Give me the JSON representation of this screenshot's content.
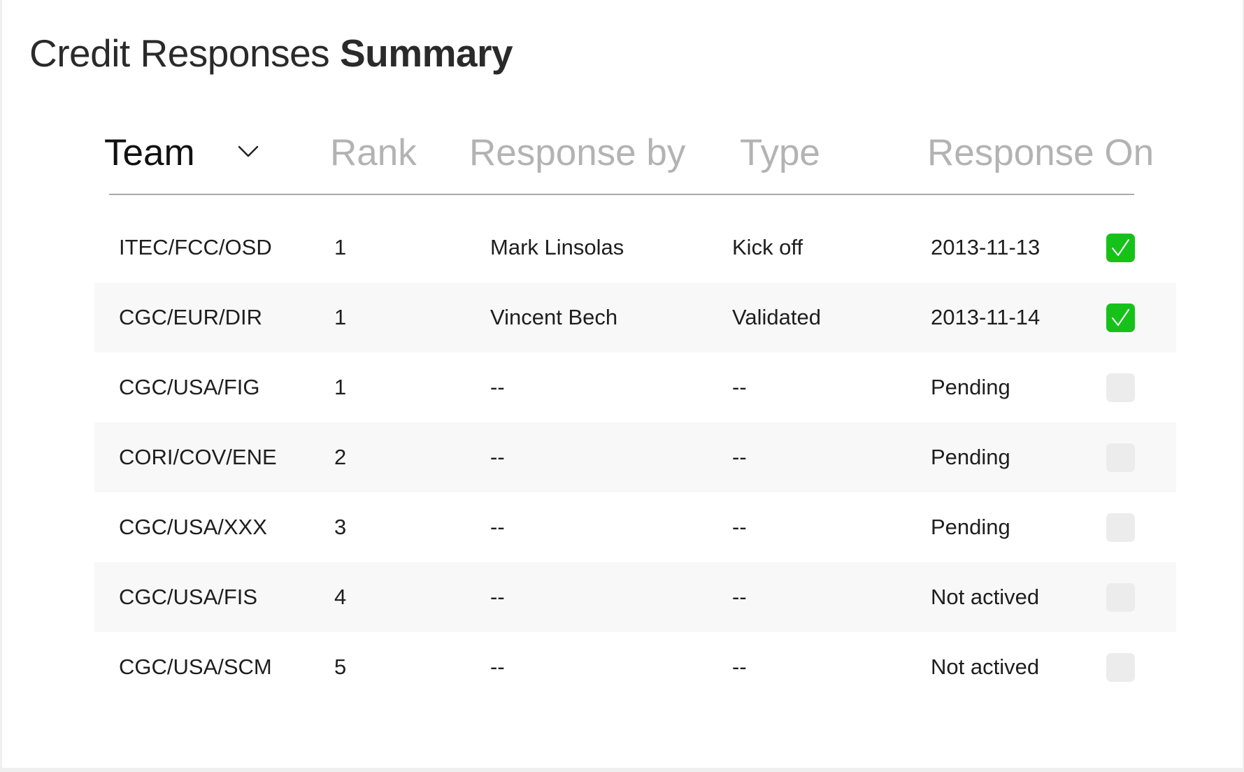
{
  "page": {
    "title_light": "Credit Responses",
    "title_bold": "Summary"
  },
  "table": {
    "columns": [
      {
        "label": "Team",
        "active": true
      },
      {
        "label": "Rank",
        "active": false
      },
      {
        "label": "Response by",
        "active": false
      },
      {
        "label": "Type",
        "active": false
      },
      {
        "label": "Response On",
        "active": false
      }
    ],
    "sort_icon": "chevron-down-icon",
    "check_icon": "checkmark-icon",
    "rows": [
      {
        "team": "ITEC/FCC/OSD",
        "rank": "1",
        "response_by": "Mark Linsolas",
        "type": "Kick off",
        "response_on": "2013-11-13",
        "checked": true
      },
      {
        "team": "CGC/EUR/DIR",
        "rank": "1",
        "response_by": "Vincent Bech",
        "type": "Validated",
        "response_on": "2013-11-14",
        "checked": true
      },
      {
        "team": "CGC/USA/FIG",
        "rank": "1",
        "response_by": "--",
        "type": "--",
        "response_on": "Pending",
        "checked": false
      },
      {
        "team": "CORI/COV/ENE",
        "rank": "2",
        "response_by": "--",
        "type": "--",
        "response_on": "Pending",
        "checked": false
      },
      {
        "team": "CGC/USA/XXX",
        "rank": "3",
        "response_by": "--",
        "type": "--",
        "response_on": "Pending",
        "checked": false
      },
      {
        "team": "CGC/USA/FIS",
        "rank": "4",
        "response_by": "--",
        "type": "--",
        "response_on": "Not actived",
        "checked": false
      },
      {
        "team": "CGC/USA/SCM",
        "rank": "5",
        "response_by": "--",
        "type": "--",
        "response_on": "Not actived",
        "checked": false
      }
    ]
  },
  "colors": {
    "check_on": "#16c21a",
    "check_off": "#ececec",
    "header_inactive": "#b3b3b3",
    "row_alt": "#f8f8f8"
  }
}
